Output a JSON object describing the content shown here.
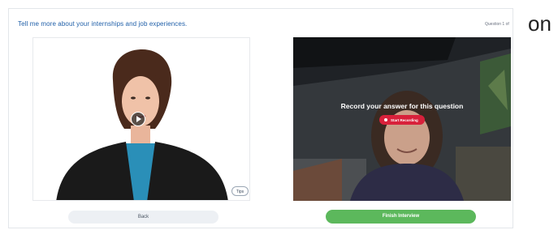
{
  "interview": {
    "question": "Tell me more about your internships and job experiences.",
    "counter": "Question 1 of"
  },
  "page_overflow_text": "on",
  "left_panel": {
    "play_icon": "play-icon",
    "tips_label": "Tips"
  },
  "right_panel": {
    "prompt": "Record your answer for this question",
    "record_label": "Start Recording",
    "record_icon": "record-dot-icon",
    "accent": "#d8213b"
  },
  "footer": {
    "back_label": "Back",
    "finish_label": "Finish Interview",
    "finish_color": "#5cb85c"
  }
}
